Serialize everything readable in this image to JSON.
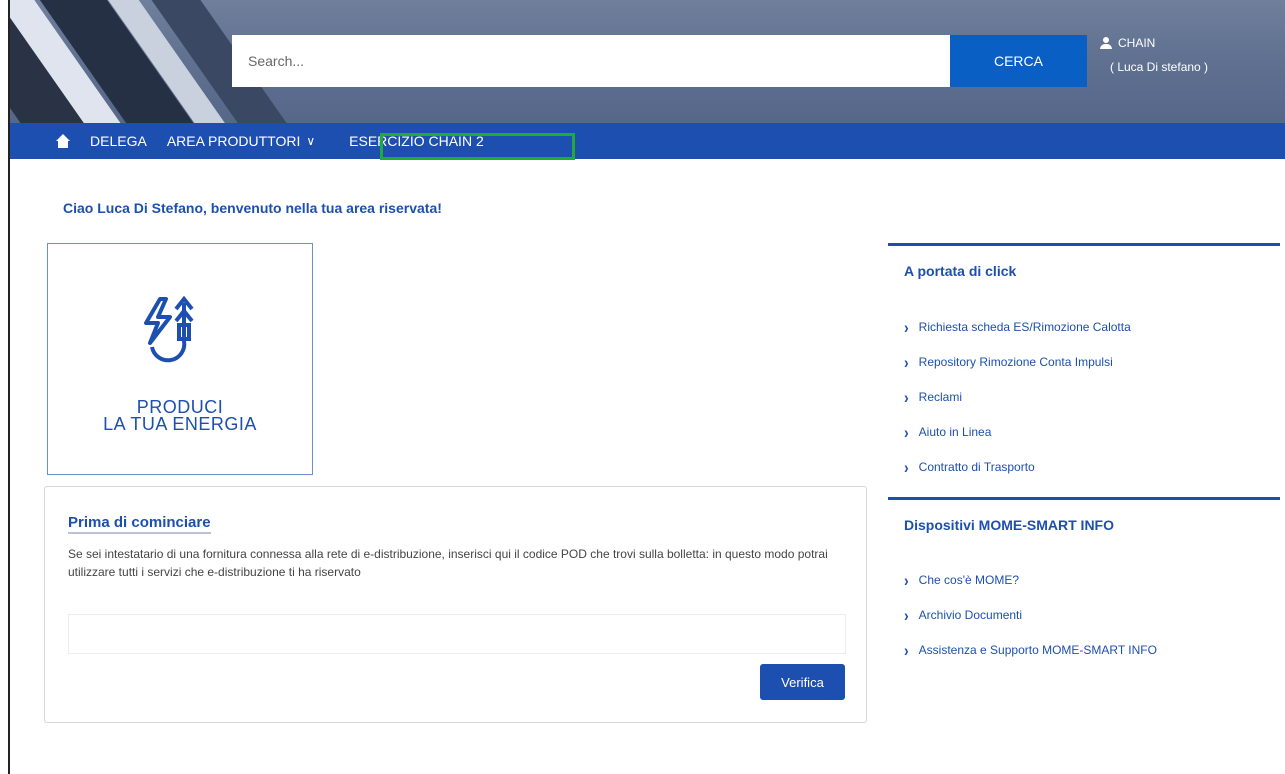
{
  "header": {
    "search_placeholder": "Search...",
    "search_button": "CERCA",
    "user_label": "CHAIN",
    "user_name": "( Luca Di stefano )"
  },
  "nav": {
    "items": [
      {
        "label": "DELEGA"
      },
      {
        "label": "AREA PRODUTTORI"
      },
      {
        "label": "ESERCIZIO CHAIN 2"
      }
    ]
  },
  "greeting": "Ciao Luca Di Stefano, benvenuto nella tua area riservata!",
  "promo": {
    "line1": "PRODUCI",
    "line2": "LA TUA ENERGIA"
  },
  "pod_card": {
    "title": "Prima di cominciare",
    "description": "Se sei intestatario di una fornitura connessa alla rete di e-distribuzione, inserisci qui il codice POD che trovi sulla bolletta: in questo modo potrai utilizzare tutti i servizi che e-distribuzione ti ha riservato",
    "input_value": "",
    "button": "Verifica"
  },
  "quick_links": {
    "title": "A portata di click",
    "items": [
      {
        "label": "Richiesta scheda ES/Rimozione Calotta"
      },
      {
        "label": "Repository Rimozione Conta Impulsi"
      },
      {
        "label": "Reclami"
      },
      {
        "label": "Aiuto in Linea"
      },
      {
        "label": "Contratto di Trasporto"
      }
    ]
  },
  "mome": {
    "title": "Dispositivi MOME-SMART INFO",
    "items": [
      {
        "label": "Che cos'è MOME?"
      },
      {
        "label": "Archivio Documenti"
      },
      {
        "label": "Assistenza e Supporto MOME-SMART INFO"
      }
    ]
  },
  "colors": {
    "brand_blue": "#1d4fb0",
    "search_button": "#0a5fc5",
    "highlight": "#1faa3a"
  }
}
